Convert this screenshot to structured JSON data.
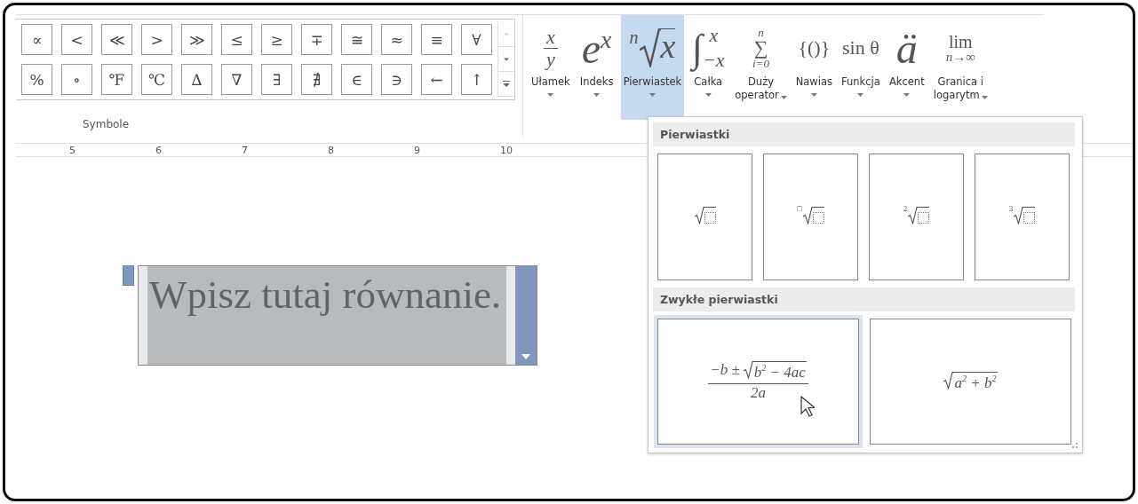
{
  "symbols": {
    "rows": [
      [
        "∝",
        "<",
        "≪",
        ">",
        "≫",
        "≤",
        "≥",
        "∓",
        "≅",
        "≈",
        "≡",
        "∀"
      ],
      [
        "%",
        "∘",
        "℉",
        "℃",
        "∆",
        "∇",
        "∃",
        "∄",
        "∈",
        "∋",
        "←",
        "↑"
      ]
    ],
    "group_label": "Symbole"
  },
  "structures": [
    {
      "glyph": {
        "kind": "fraction",
        "top": "x",
        "bottom": "y"
      },
      "label": [
        "Ułamek"
      ],
      "selected": false
    },
    {
      "glyph": {
        "kind": "power",
        "base": "e",
        "exp": "x"
      },
      "label": [
        "Indeks"
      ],
      "selected": false
    },
    {
      "glyph": {
        "kind": "root",
        "index": "n",
        "radicand": "x"
      },
      "label": [
        "Pierwiastek"
      ],
      "selected": true
    },
    {
      "glyph": {
        "kind": "integral",
        "sign": "∫",
        "upper": "x",
        "lower": "−x"
      },
      "label": [
        "Całka"
      ],
      "selected": false
    },
    {
      "glyph": {
        "kind": "operator",
        "sign": "∑",
        "upper": "n",
        "lower": "i=0"
      },
      "label": [
        "Duży",
        "operator"
      ],
      "selected": false
    },
    {
      "glyph": {
        "kind": "text",
        "text": "{()}"
      },
      "label": [
        "Nawias"
      ],
      "selected": false
    },
    {
      "glyph": {
        "kind": "text",
        "text": "sin θ"
      },
      "label": [
        "Funkcja"
      ],
      "selected": false
    },
    {
      "glyph": {
        "kind": "big",
        "text": "ä"
      },
      "label": [
        "Akcent"
      ],
      "selected": false
    },
    {
      "glyph": {
        "kind": "limit",
        "top": "lim",
        "bottom": "n→∞"
      },
      "label": [
        "Granica i",
        "logarytm"
      ],
      "selected": false
    }
  ],
  "ruler": [
    "5",
    "6",
    "7",
    "8",
    "9",
    "10"
  ],
  "equation": {
    "placeholder": "Wpisz tutaj równanie."
  },
  "dropdown": {
    "sections": [
      {
        "title": "Pierwiastki",
        "items": [
          {
            "kind": "root",
            "selected": false
          },
          {
            "kind": "root",
            "index": "□",
            "selected": false
          },
          {
            "kind": "root",
            "index": "2",
            "selected": false
          },
          {
            "kind": "root",
            "index": "3",
            "selected": false
          }
        ]
      },
      {
        "title": "Zwykłe pierwiastki",
        "items": [
          {
            "kind": "quadratic",
            "prefix": "−b ±",
            "radicand": "b$^{2}$ − 4ac",
            "denominator": "2a",
            "selected": true
          },
          {
            "kind": "radical",
            "radicand": "a$^{2}$ + b$^{2}$",
            "selected": false
          }
        ]
      }
    ]
  }
}
